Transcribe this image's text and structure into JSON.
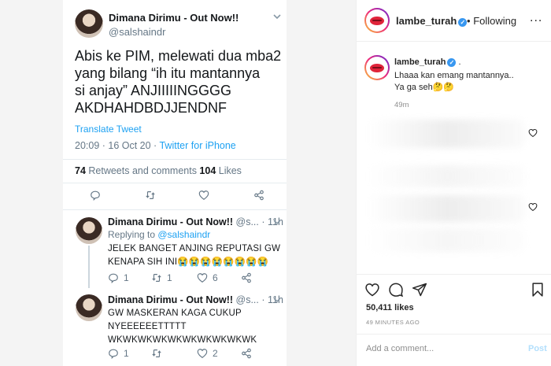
{
  "tweet": {
    "author_name": "Dimana Dirimu - Out Now!!",
    "handle": "@salshaindr",
    "text": "Abis ke PIM, melewati dua mba2\nyang bilang “ih itu mantannya\nsi anjay” ANJIIIIINGGGG\nAKDHAHDBDJJENDNF",
    "translate_label": "Translate Tweet",
    "timestamp": "20:09 · 16 Oct 20 · ",
    "source": "Twitter for iPhone",
    "retweets_count": "74",
    "retweets_label": " Retweets and comments  ",
    "likes_count": "104",
    "likes_label": " Likes"
  },
  "replies": [
    {
      "author_name": "Dimana Dirimu - Out Now!!",
      "handle_time": " @s... · 11h",
      "replying_prefix": "Replying to ",
      "replying_to": "@salshaindr",
      "text": "JELEK BANGET ANJING REPUTASI GW\nKENAPA SIH INI😭😭😭😭😭😭😭😭",
      "reply_count": "1",
      "retweet_count": "1",
      "like_count": "6"
    },
    {
      "author_name": "Dimana Dirimu - Out Now!!",
      "handle_time": " @s... · 11h",
      "text": "GW MASKERAN KAGA CUKUP\nNYEEEEEETTTTT\nWKWKWKWKWKWKWKWKWKWK",
      "reply_count": "1",
      "retweet_count": "",
      "like_count": "2"
    }
  ],
  "instagram": {
    "username": "lambe_turah",
    "follow_separator": "•",
    "follow_label": "Following",
    "more_label": "...",
    "caption_user": "lambe_turah",
    "caption_suffix": " .",
    "caption_text": "Lhaaa kan emang mantannya..\nYa ga seh🤔🤔",
    "caption_time": "49m",
    "likes": "50,411 likes",
    "posted_ago": "49 MINUTES AGO",
    "comment_placeholder": "Add a comment...",
    "post_label": "Post"
  },
  "colors": {
    "twitter_blue": "#1da1f2",
    "ig_link_disabled": "#b2dffc",
    "verified": "#3897f0"
  },
  "icons": [
    "chevron-down-icon",
    "reply-icon",
    "retweet-icon",
    "heart-icon",
    "share-icon",
    "verified-icon",
    "comment-icon",
    "send-icon",
    "bookmark-icon"
  ]
}
